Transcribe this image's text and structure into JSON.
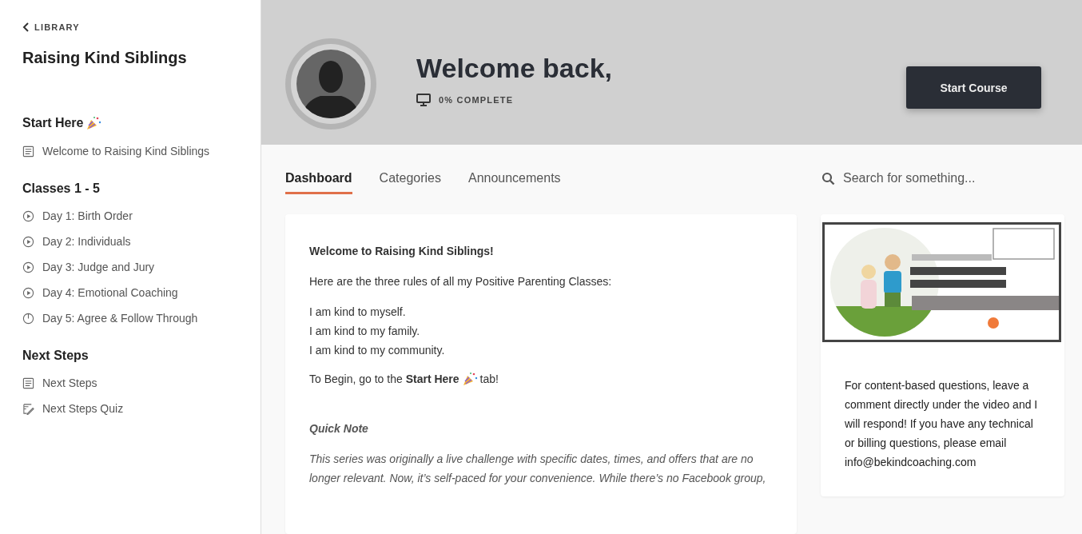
{
  "sidebar": {
    "back_link": "LIBRARY",
    "course_title": "Raising Kind Siblings",
    "sections": [
      {
        "title": "Start Here",
        "items": [
          {
            "kind": "text",
            "label": "Welcome to Raising Kind Siblings"
          }
        ]
      },
      {
        "title": "Classes 1 - 5",
        "items": [
          {
            "kind": "video",
            "label": "Day 1: Birth Order"
          },
          {
            "kind": "video",
            "label": "Day 2: Individuals"
          },
          {
            "kind": "video",
            "label": "Day 3: Judge and Jury"
          },
          {
            "kind": "video",
            "label": "Day 4: Emotional Coaching"
          },
          {
            "kind": "scheduled",
            "label": "Day 5: Agree & Follow Through"
          }
        ]
      },
      {
        "title": "Next Steps",
        "items": [
          {
            "kind": "text",
            "label": "Next Steps"
          },
          {
            "kind": "quiz",
            "label": "Next Steps Quiz"
          }
        ]
      }
    ]
  },
  "header": {
    "greeting": "Welcome back,",
    "progress": "0% COMPLETE",
    "button": "Start Course"
  },
  "tabs": [
    {
      "label": "Dashboard",
      "selected": true
    },
    {
      "label": "Categories",
      "selected": false
    },
    {
      "label": "Announcements",
      "selected": false
    }
  ],
  "search": {
    "placeholder": "Search for something..."
  },
  "welcome_card": {
    "heading": "Welcome to Raising Kind Siblings!",
    "intro": "Here are the three rules of all my Positive Parenting Classes:",
    "rules": [
      "I am kind to myself.",
      "I am kind to my family.",
      "I am kind to my community."
    ],
    "begin_before": "To Begin, go to the **Start Here**",
    "begin_after": "tab!",
    "note_title": "Quick Note",
    "note": "This series was originally a live challenge with specific dates, times, and offers that are no longer relevant. Now, it’s self-paced for your convenience. While there’s no Facebook group,"
  },
  "side_card": {
    "text": "For content-based questions, leave a comment directly under the video and I will respond! If you have any technical or billing questions, please email info@bekindcoaching.com"
  }
}
